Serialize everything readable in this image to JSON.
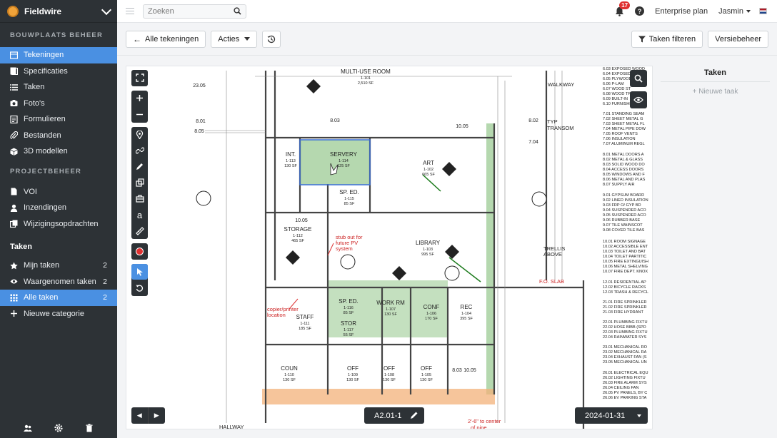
{
  "sidebar": {
    "brand": "Fieldwire",
    "section1": "BOUWPLAATS BEHEER",
    "items1": [
      {
        "label": "Tekeningen",
        "icon": "drawings-icon",
        "active": true
      },
      {
        "label": "Specificaties",
        "icon": "specifications-icon"
      },
      {
        "label": "Taken",
        "icon": "list-icon"
      },
      {
        "label": "Foto's",
        "icon": "camera-icon"
      },
      {
        "label": "Formulieren",
        "icon": "forms-icon"
      },
      {
        "label": "Bestanden",
        "icon": "paperclip-icon"
      },
      {
        "label": "3D modellen",
        "icon": "cube-icon"
      }
    ],
    "section2": "PROJECTBEHEER",
    "items2": [
      {
        "label": "VOI",
        "icon": "document-icon"
      },
      {
        "label": "Inzendingen",
        "icon": "user-icon"
      },
      {
        "label": "Wijzigingsopdrachten",
        "icon": "change-orders-icon"
      }
    ],
    "taken_title": "Taken",
    "task_items": [
      {
        "label": "Mijn taken",
        "count": "2",
        "icon": "star-icon"
      },
      {
        "label": "Waargenomen taken",
        "count": "2",
        "icon": "eye-icon"
      },
      {
        "label": "Alle taken",
        "count": "2",
        "icon": "grid-icon",
        "active": true
      },
      {
        "label": "Nieuwe categorie",
        "count": "",
        "icon": "plus-icon"
      }
    ]
  },
  "topbar": {
    "search_placeholder": "Zoeken",
    "notification_count": "17",
    "plan": "Enterprise plan",
    "user": "Jasmin"
  },
  "toolbar": {
    "back_label": "Alle tekeningen",
    "actions_label": "Acties",
    "filter_label": "Taken filteren",
    "version_label": "Versiebeheer"
  },
  "viewer": {
    "sheet": "A2.01-1",
    "date": "2024-01-31"
  },
  "tasks_panel": {
    "title": "Taken",
    "new_task": "+ Nieuwe taak"
  },
  "drawing": {
    "rooms": [
      {
        "name": "MULTI-USE ROOM",
        "num": "1-101",
        "area": "2,510 SF"
      },
      {
        "name": "SERVERY",
        "num": "1-114",
        "area": "125 SF"
      },
      {
        "name": "INT.",
        "num": "1-113",
        "area": "130 SF"
      },
      {
        "name": "ART",
        "num": "1-102",
        "area": "665 SF"
      },
      {
        "name": "SP. ED.",
        "num": "1-115",
        "area": "85 SF"
      },
      {
        "name": "STORAGE",
        "num": "1-112",
        "area": "465 SF"
      },
      {
        "name": "LIBRARY",
        "num": "1-103",
        "area": "995 SF"
      },
      {
        "name": "STAFF",
        "num": "1-111",
        "area": "185 SF"
      },
      {
        "name": "SP. ED.",
        "num": "1-116",
        "area": "85 SF"
      },
      {
        "name": "WORK RM",
        "num": "1-107",
        "area": "130 SF"
      },
      {
        "name": "CONF",
        "num": "1-106",
        "area": "170 SF"
      },
      {
        "name": "REC",
        "num": "1-104",
        "area": "395 SF"
      },
      {
        "name": "STOR",
        "num": "1-117",
        "area": "55 SF"
      },
      {
        "name": "COUN",
        "num": "1-110",
        "area": "130 SF"
      },
      {
        "name": "OFF",
        "num": "1-109",
        "area": "130 SF"
      },
      {
        "name": "OFF",
        "num": "1-108",
        "area": "130 SF"
      },
      {
        "name": "OFF",
        "num": "1-105",
        "area": "130 SF"
      }
    ],
    "notes": [
      "stub out for",
      "future PV",
      "system",
      "copier/printer",
      "location",
      "TRELLIS",
      "ABOVE",
      "F.O. SLAB",
      "HALLWAY",
      "TRANSOM",
      "TYP",
      "2'-6\" to center",
      "of pipe",
      "WALKWAY"
    ],
    "keys": [
      "23.05",
      "8.01",
      "8.05",
      "8.03",
      "10.05",
      "8.02",
      "7.04",
      "10.05",
      "8.03",
      "10.05"
    ],
    "legend": [
      "6.03 EXPOSED WOOD",
      "6.04 EXPOSED",
      "6.05 PLYWOOD",
      "6.06 P-LAM",
      "6.07 WOOD ST",
      "6.08 WOOD TRIM",
      "6.09 BUILT-IN",
      "6.10 FURNISHING",
      "7.01 STANDING SEAM",
      "7.02 SHEET METAL G",
      "7.03 SHEET METAL FL",
      "7.04 METAL PIPE DOW",
      "7.05 ROOF VENTS",
      "7.06 INSULATION",
      "7.07 ALUMINUM REGL",
      "8.01 METAL DOORS A",
      "8.02 METAL & GLASS",
      "8.03 SOLID WOOD DO",
      "8.04 ACCESS DOORS",
      "8.05 WINDOWS AND F",
      "8.06 METAL AND PLAS",
      "8.07 SUPPLY AIR",
      "9.01 GYPSUM BOARD",
      "9.02 LINED INSULATION",
      "9.03 FRP O/ GYP BD",
      "9.04 SUSPENDED ACO",
      "9.05 SUSPENDED ACO",
      "9.06 RUBBER BASE",
      "9.07 TILE WAINSCOT",
      "9.08 COVED TILE BAS",
      "10.01 ROOM SIGNAGE",
      "10.02 ACCESSIBLE ENT",
      "10.03 TOILET AND BAT",
      "10.04 TOILET PARTITIC",
      "10.05 FIRE EXTINGUISH",
      "10.06 METAL SHELVING",
      "10.07 FIRE DEPT. KNOX",
      "12.01 RESIDENTIAL AP",
      "12.02 BICYCLE RACKS",
      "12.03 TRASH & RECYCL",
      "21.01 FIRE SPRINKLER",
      "21.02 FIRE SPRINKLER",
      "21.03 FIRE HYDRANT",
      "22.01 PLUMBING FIXTU",
      "22.02 HOSE BIBB (SPD",
      "22.03 PLUMBING FIXTU",
      "22.04 RAINWATER SYS",
      "23.01 MECHANICAL RO",
      "23.02 MECHANICAL RA",
      "23.04 EXHAUST FAN (S",
      "23.05 MECHANICAL UN",
      "26.01 ELECTRICAL EQU",
      "26.02 LIGHTING FIXTU",
      "26.03 FIRE ALARM SYS",
      "26.04 CEILING FAN",
      "26.05 PV PANELS, BY C",
      "26.06 EV PARKING STA"
    ]
  }
}
